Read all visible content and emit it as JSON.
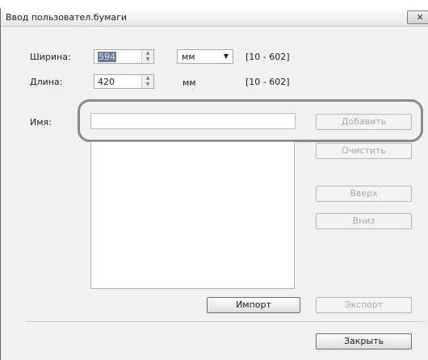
{
  "window": {
    "title": "Ввод пользовател.бумаги",
    "close_glyph": "✕"
  },
  "width": {
    "label": "Ширина:",
    "value": "594",
    "unit": "мм",
    "range": "[10 - 602]"
  },
  "length": {
    "label": "Длина:",
    "value": "420",
    "unit": "мм",
    "range": "[10 - 602]"
  },
  "name": {
    "label": "Имя:",
    "value": ""
  },
  "buttons": {
    "add": "Добавить",
    "clear": "Очистить",
    "up": "Вверх",
    "down": "Вниз",
    "import": "Импорт",
    "export": "Экспорт",
    "close": "Закрыть"
  }
}
